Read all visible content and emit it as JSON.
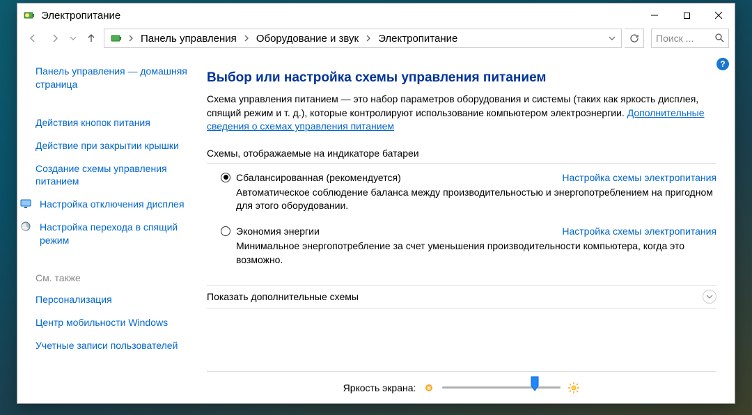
{
  "window": {
    "title": "Электропитание"
  },
  "breadcrumb": {
    "items": [
      "Панель управления",
      "Оборудование и звук",
      "Электропитание"
    ]
  },
  "search": {
    "placeholder": "Поиск ..."
  },
  "sidebar": {
    "home": "Панель управления — домашняя страница",
    "links": [
      "Действия кнопок питания",
      "Действие при закрытии крышки",
      "Создание схемы управления питанием",
      "Настройка отключения дисплея",
      "Настройка перехода в спящий режим"
    ],
    "see_also_label": "См. также",
    "see_also": [
      "Персонализация",
      "Центр мобильности Windows",
      "Учетные записи пользователей"
    ]
  },
  "main": {
    "title": "Выбор или настройка схемы управления питанием",
    "description": "Схема управления питанием — это набор параметров оборудования и системы (таких как яркость дисплея, спящий режим и т. д.), которые контролируют использование компьютером электроэнергии.",
    "more_info_link": "Дополнительные сведения о схемах управления питанием",
    "section_label": "Схемы, отображаемые на индикаторе батареи",
    "plans": [
      {
        "name": "Сбалансированная (рекомендуется)",
        "selected": true,
        "config_link": "Настройка схемы электропитания",
        "description": "Автоматическое соблюдение баланса между производительностью и энергопотреблением на пригодном для этого оборудовании."
      },
      {
        "name": "Экономия энергии",
        "selected": false,
        "config_link": "Настройка схемы электропитания",
        "description": "Минимальное энергопотребление за счет уменьшения производительности компьютера, когда это возможно."
      }
    ],
    "expander_label": "Показать дополнительные схемы"
  },
  "footer": {
    "brightness_label": "Яркость экрана:",
    "brightness_percent": 78
  }
}
